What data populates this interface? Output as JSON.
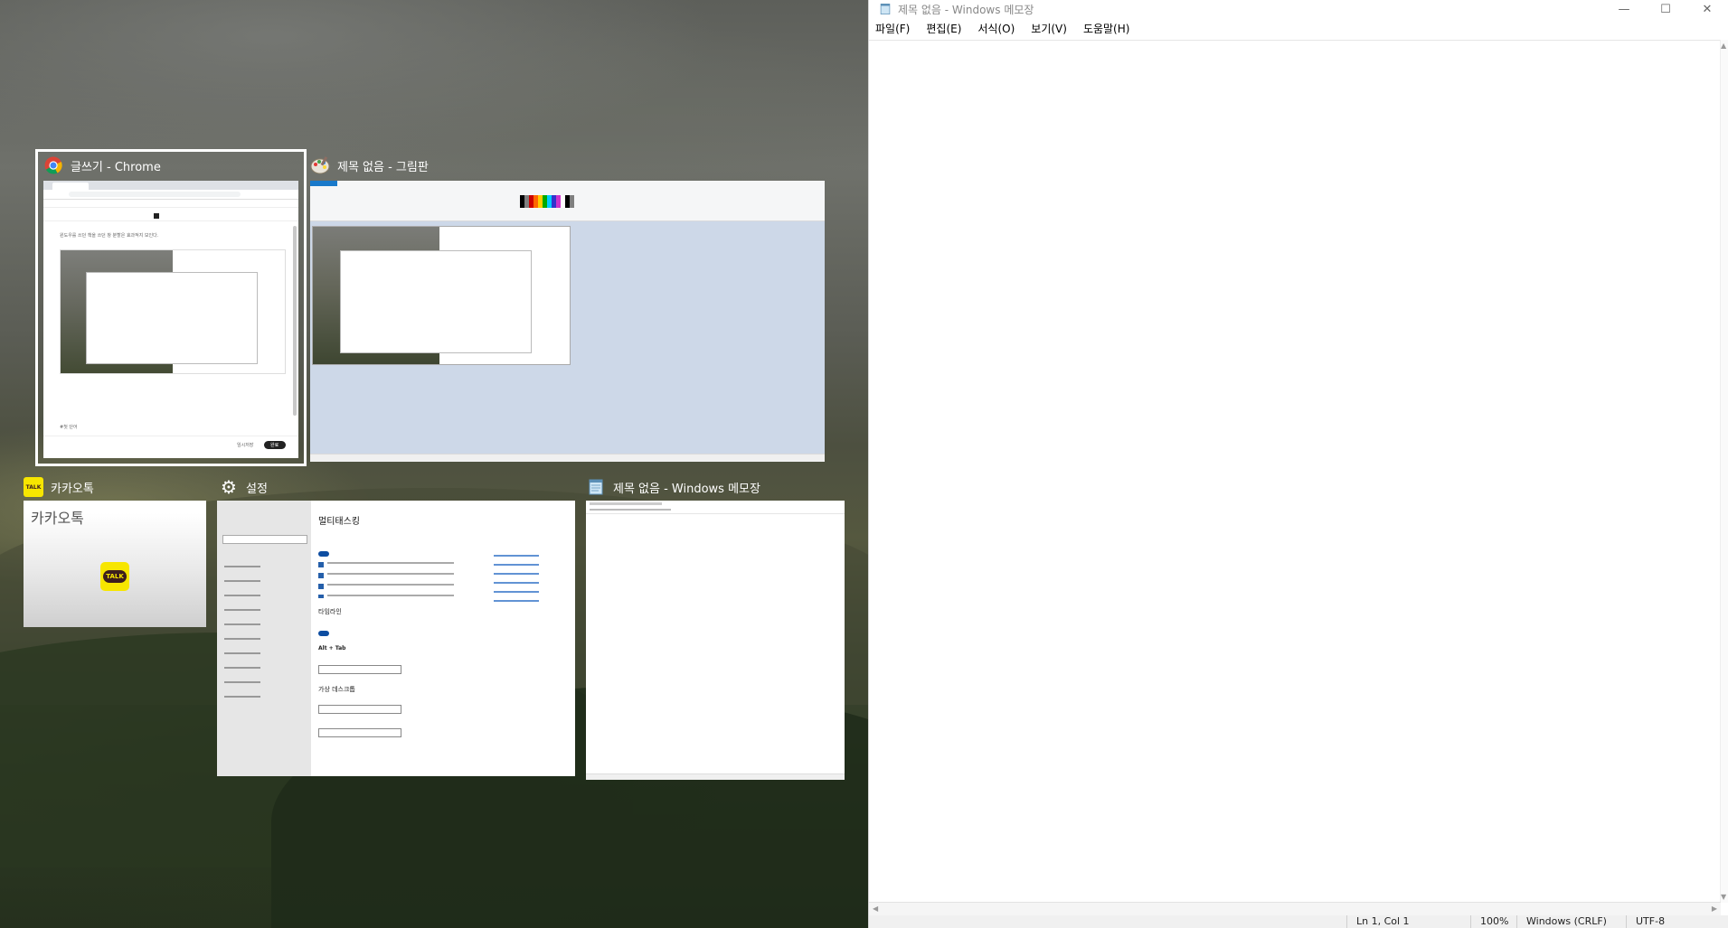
{
  "desktop": {
    "wallpaper": "mountain-landscape"
  },
  "task_view": {
    "windows": [
      {
        "app": "chrome",
        "title": "글쓰기 - Chrome",
        "icon": "chrome-icon",
        "preview": {
          "body_text": "윈도우를 쓰던 책을 쓰던 창 분할은 효과적지 보인다.",
          "footer_left": "#첫 단어",
          "footer_btn1": "임시저장",
          "footer_btn2": "완료"
        }
      },
      {
        "app": "paint",
        "title": "제목 없음 - 그림판",
        "icon": "paint-icon"
      },
      {
        "app": "kakaotalk",
        "title": "카카오톡",
        "icon": "kakaotalk-icon",
        "preview": {
          "header": "카카오톡",
          "logo_text": "TALK"
        }
      },
      {
        "app": "settings",
        "title": "설정",
        "icon": "gear-icon",
        "preview": {
          "page_title": "멀티태스킹",
          "section1": "타임라인",
          "section2": "Alt + Tab",
          "section3": "가상 데스크톱"
        }
      },
      {
        "app": "notepad",
        "title": "제목 없음 - Windows 메모장",
        "icon": "notepad-icon"
      }
    ]
  },
  "notepad": {
    "title": "제목 없음 - Windows 메모장",
    "menu": [
      "파일(F)",
      "편집(E)",
      "서식(O)",
      "보기(V)",
      "도움말(H)"
    ],
    "status": {
      "position": "Ln 1, Col 1",
      "zoom": "100%",
      "line_ending": "Windows (CRLF)",
      "encoding": "UTF-8"
    }
  },
  "colors": {
    "selection_outline": "#ffffff",
    "kakao_yellow": "#f7e600",
    "toggle_blue": "#0d4da1"
  }
}
